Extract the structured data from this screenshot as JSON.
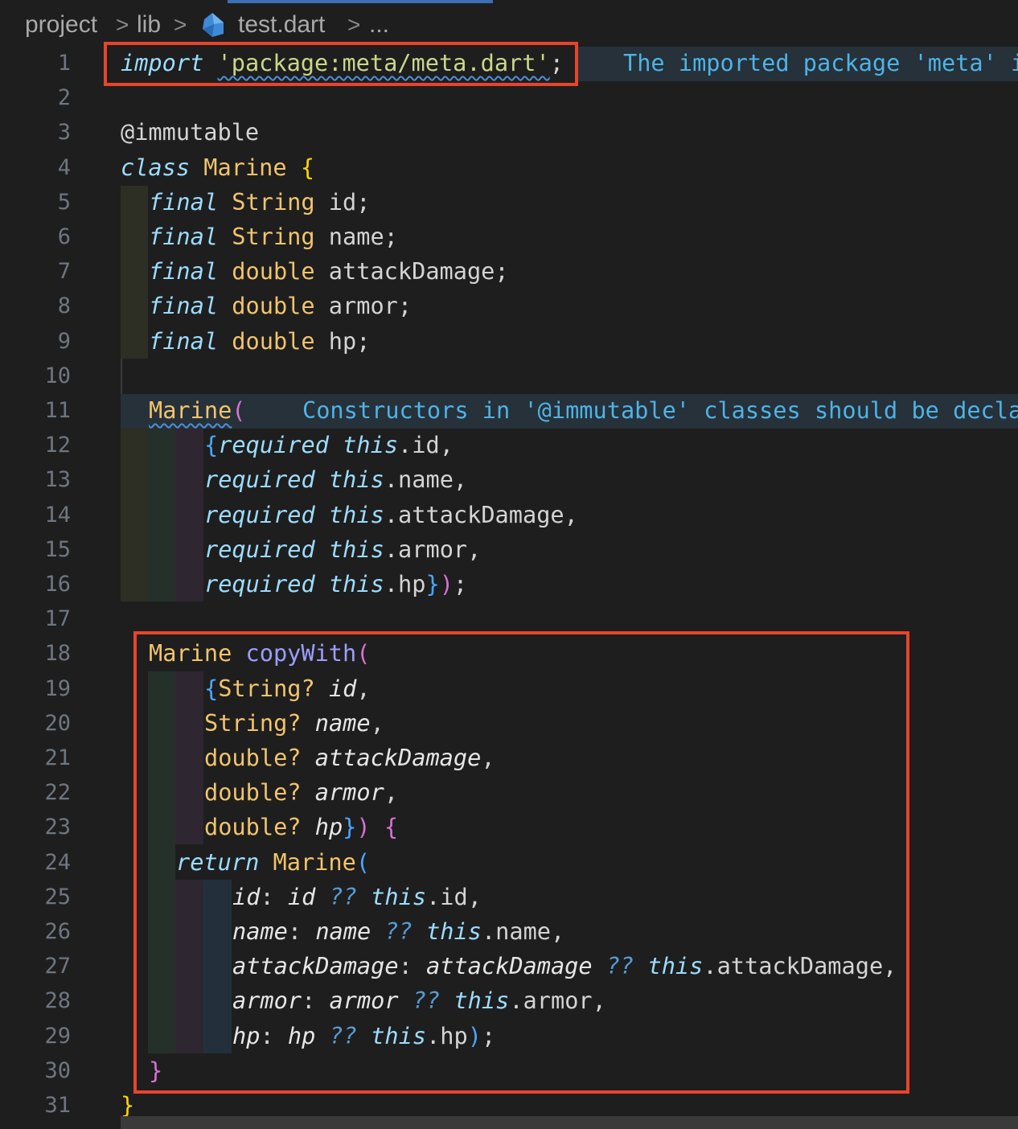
{
  "breadcrumb": {
    "items": [
      "project",
      "lib",
      "test.dart",
      "..."
    ],
    "separator": ">"
  },
  "editor": {
    "hints": {
      "line1": "The imported package 'meta' i",
      "line11": "Constructors in '@immutable' classes should be decla"
    },
    "line_numbers": [
      "1",
      "2",
      "3",
      "4",
      "5",
      "6",
      "7",
      "8",
      "9",
      "10",
      "11",
      "12",
      "13",
      "14",
      "15",
      "16",
      "17",
      "18",
      "19",
      "20",
      "21",
      "22",
      "23",
      "24",
      "25",
      "26",
      "27",
      "28",
      "29",
      "30",
      "31"
    ]
  },
  "colors": {
    "background": "#1e1e1e",
    "annotation_box": "#e8442c",
    "tab_indicator": "#3c6fb3"
  }
}
